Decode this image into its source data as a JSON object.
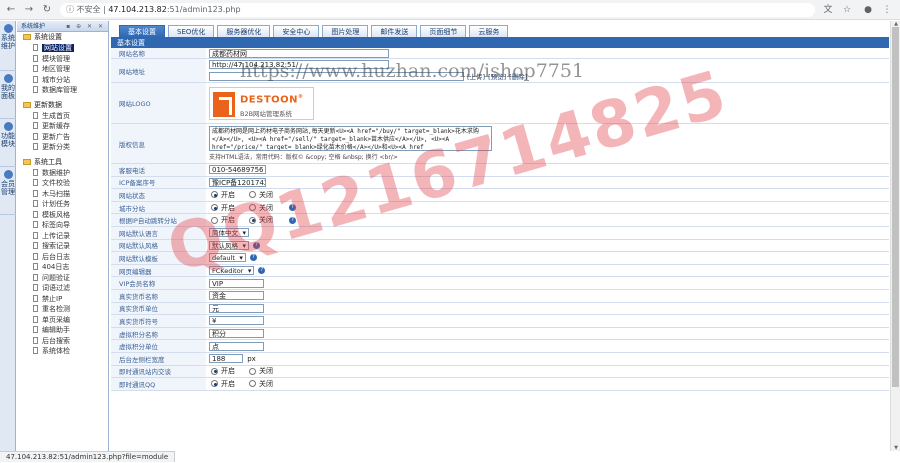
{
  "browser": {
    "not_secure": "不安全",
    "url_host": "47.104.213.82",
    "url_rest": ":51/admin123.php"
  },
  "left_tabs": [
    {
      "label": "系统维护"
    },
    {
      "label": "我的面板"
    },
    {
      "label": "功能模块"
    },
    {
      "label": "会员管理"
    }
  ],
  "sidebar": {
    "title": "系统维护",
    "controls": "▪ ⊕ ✕ ✕",
    "groups": [
      {
        "label": "系统设置",
        "items": [
          {
            "label": "网站设置",
            "selected": true
          },
          {
            "label": "模块管理"
          },
          {
            "label": "地区管理"
          },
          {
            "label": "城市分站"
          },
          {
            "label": "数据库管理"
          }
        ]
      },
      {
        "label": "更新数据",
        "items": [
          {
            "label": "生成首页"
          },
          {
            "label": "更新缓存"
          },
          {
            "label": "更新广告"
          },
          {
            "label": "更新分类"
          }
        ]
      },
      {
        "label": "系统工具",
        "items": [
          {
            "label": "数据维护"
          },
          {
            "label": "文件校验"
          },
          {
            "label": "木马扫描"
          },
          {
            "label": "计划任务"
          },
          {
            "label": "模板风格"
          },
          {
            "label": "标签向导"
          },
          {
            "label": "上传记录"
          },
          {
            "label": "搜索记录"
          },
          {
            "label": "后台日志"
          },
          {
            "label": "404日志"
          },
          {
            "label": "问题验证"
          },
          {
            "label": "词语过滤"
          },
          {
            "label": "禁止IP"
          },
          {
            "label": "重名检测"
          },
          {
            "label": "单页采编"
          },
          {
            "label": "编辑助手"
          },
          {
            "label": "后台搜索"
          },
          {
            "label": "系统体检"
          }
        ]
      }
    ]
  },
  "topnav": {
    "tabs": [
      {
        "label": "基本设置",
        "active": true
      },
      {
        "label": "SEO优化"
      },
      {
        "label": "服务器优化"
      },
      {
        "label": "安全中心"
      },
      {
        "label": "图片处理"
      },
      {
        "label": "邮件发送"
      },
      {
        "label": "页面细节"
      },
      {
        "label": "云服务"
      }
    ]
  },
  "section_title": "基本设置",
  "form": {
    "site_name": {
      "label": "网站名称",
      "value": "成都药材网"
    },
    "site_url": {
      "label": "网站地址",
      "value": "http://47.104.213.82:51/",
      "links": [
        "[上传]",
        "[预览]",
        "[删除]"
      ]
    },
    "logo": {
      "label": "网站LOGO",
      "brand": "DESTOON",
      "brand_mark": "®",
      "sub": "B2B网站管理系统"
    },
    "copyright": {
      "label": "版权信息",
      "value": "成都药材网是网上药材电子商务网站,每天更新<U><A href=\"/buy/\" target=_blank>花木求购</A></U>, <U><A href=\"/sell/\" target=_blank>苗木供应</A></U>, <U><A href=\"/price/\" target=_blank>绿化苗木价格</A></U>和<U><A href",
      "hint": "支持HTML语法，常用代码：版权© &copy; 空格 &nbsp; 换行 <br/>"
    },
    "phone": {
      "label": "客服电话",
      "value": "010-54689756"
    },
    "icp": {
      "label": "ICP备案序号",
      "value": "豫ICP备12017429号"
    },
    "site_status": {
      "label": "网站状态",
      "options": [
        "开启",
        "关闭"
      ],
      "selected": 0
    },
    "city_station": {
      "label": "城市分站",
      "options": [
        "开启",
        "关闭"
      ],
      "selected": 0
    },
    "ip_city": {
      "label": "根据IP自动跳转分站",
      "options": [
        "开启",
        "关闭"
      ],
      "selected": 1
    },
    "language": {
      "label": "网站默认语言",
      "value": "简体中文"
    },
    "style": {
      "label": "网站默认风格",
      "value": "默认风格"
    },
    "template": {
      "label": "网站默认模板",
      "value": "default"
    },
    "editor": {
      "label": "网页编辑器",
      "value": "FCKeditor"
    },
    "vip_name": {
      "label": "VIP会员名称",
      "value": "VIP"
    },
    "money_name": {
      "label": "真实货币名称",
      "value": "资金"
    },
    "money_unit": {
      "label": "真实货币单位",
      "value": "元"
    },
    "money_symbol": {
      "label": "真实货币符号",
      "value": "¥"
    },
    "credit_name": {
      "label": "虚拟积分名称",
      "value": "积分"
    },
    "credit_unit": {
      "label": "虚拟积分单位",
      "value": "点"
    },
    "left_width": {
      "label": "后台左侧栏宽度",
      "value": "188",
      "unit": "px"
    },
    "im_web": {
      "label": "即时通讯站内交谈",
      "options": [
        "开启",
        "关闭"
      ],
      "selected": 0
    },
    "im_qq": {
      "label": "即时通讯QQ",
      "options": [
        "开启",
        "关闭"
      ],
      "selected": 0
    }
  },
  "status_bar": "47.104.213.82:51/admin123.php?file=module",
  "watermark": {
    "url_text": "https://www.huzhan.com/ishop7751",
    "qq_text": "QQ1216714825"
  }
}
